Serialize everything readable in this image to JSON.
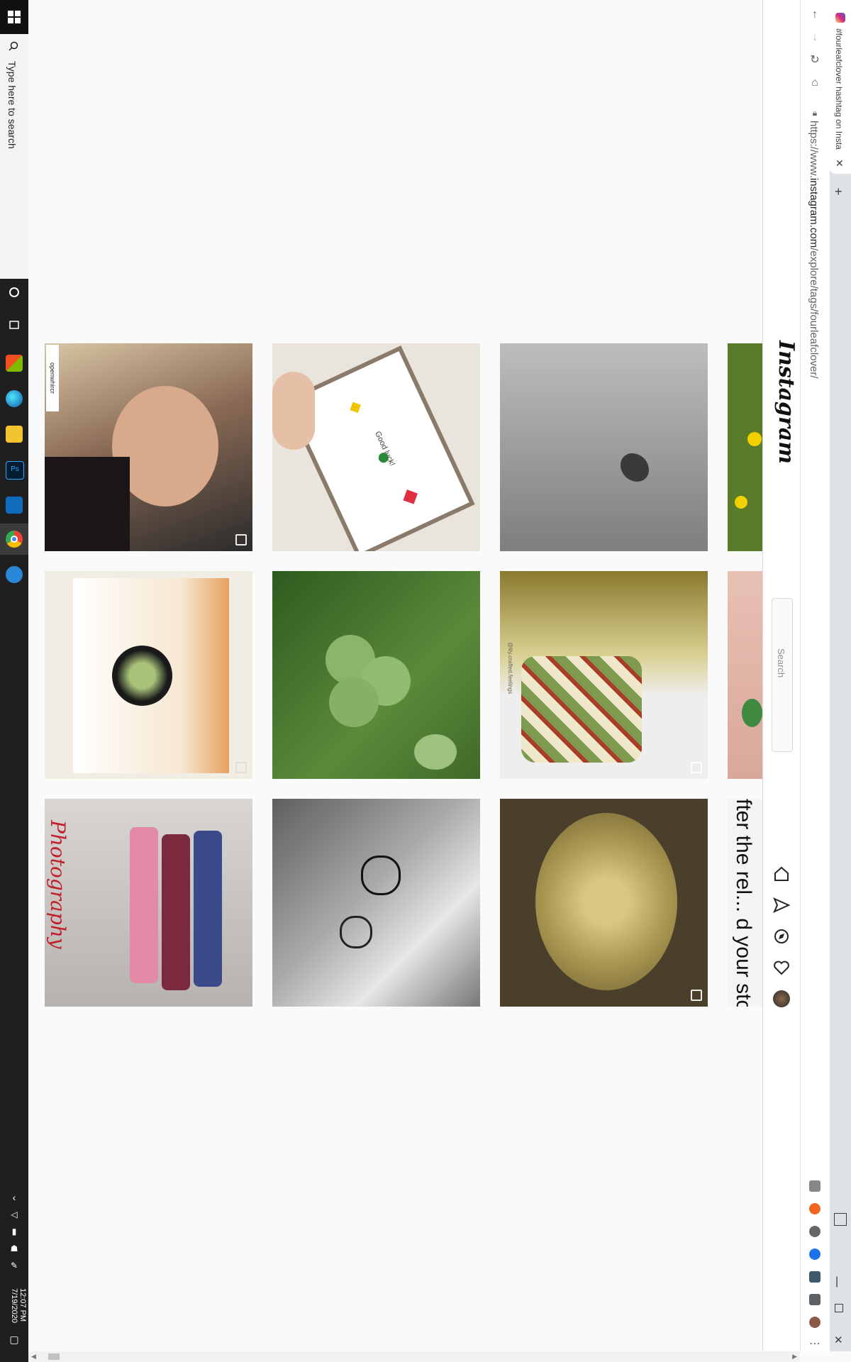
{
  "taskbar": {
    "search_placeholder": "Type here to search",
    "time": "12:07 PM",
    "date": "7/19/2020",
    "pinned_icons": [
      "cortana-circle-icon",
      "task-view-icon",
      "microsoft-store-icon",
      "edge-icon",
      "file-explorer-icon",
      "photoshop-icon",
      "outlook-icon",
      "chrome-icon",
      "settings-icon"
    ]
  },
  "browser": {
    "tab_title": "#fourleafclover hashtag on Insta",
    "url_prefix": "https://www.",
    "url_host": "instagram.com",
    "url_path": "/explore/tags/fourleafclover/"
  },
  "instagram": {
    "logo": "Instagram",
    "search_placeholder": "Search",
    "nav_icons": [
      "home-icon",
      "direct-icon",
      "explore-icon",
      "activity-heart-icon",
      "profile-avatar-icon"
    ]
  },
  "posts": [
    {
      "id": "selfie-woman",
      "username": "openwhircr",
      "multi": true,
      "color": "#8a6a55"
    },
    {
      "id": "good-luck-card",
      "caption_text": "Good luck!",
      "multi": false,
      "color": "#e9e4dc"
    },
    {
      "id": "bw-clover-wood",
      "multi": false,
      "color": "#9a9a9a"
    },
    {
      "id": "clover-flowers",
      "multi": false,
      "color": "#5a7b2a"
    },
    {
      "id": "clover-pendant",
      "multi": true,
      "color": "#f1ede4"
    },
    {
      "id": "green-clover-grass",
      "multi": false,
      "color": "#4f7a33"
    },
    {
      "id": "clover-candle",
      "watermark": "@lily.crafted.feelings",
      "multi": true,
      "color": "#c9b77a"
    },
    {
      "id": "clover-hand",
      "multi": false,
      "color": "#d9a89a"
    },
    {
      "id": "three-boys",
      "watermark": "Photography",
      "multi": false,
      "color": "#c7c3c1"
    },
    {
      "id": "clover-tattoo",
      "multi": false,
      "color": "#8b8b8b"
    },
    {
      "id": "glass-tea",
      "multi": true,
      "color": "#8d7b40"
    },
    {
      "id": "stories-text",
      "text": "fter the rel... d your stories a Pandora",
      "multi": false,
      "color": "#f4f4f4"
    }
  ]
}
